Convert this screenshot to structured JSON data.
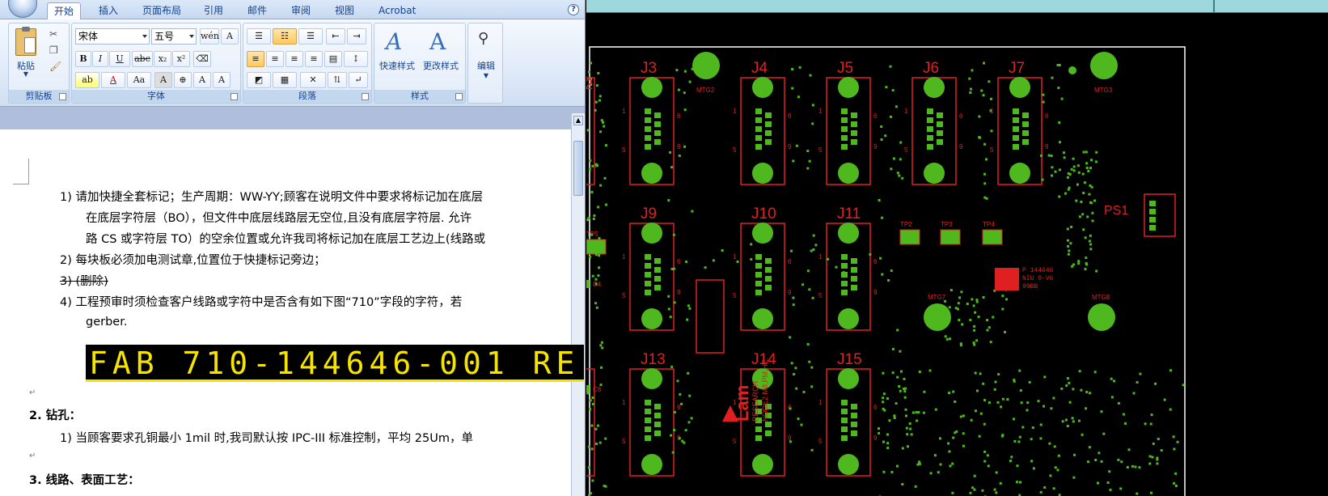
{
  "ribbon": {
    "tabs": [
      "开始",
      "插入",
      "页面布局",
      "引用",
      "邮件",
      "审阅",
      "视图",
      "Acrobat"
    ],
    "active_tab": "开始",
    "clipboard": {
      "paste_label": "粘贴",
      "group_label": "剪贴板"
    },
    "font": {
      "name": "宋体",
      "size": "五号",
      "group_label": "字体"
    },
    "paragraph": {
      "group_label": "段落"
    },
    "styles": {
      "quick_styles_label": "快速样式",
      "change_styles_label": "更改样式",
      "group_label": "样式"
    },
    "editing": {
      "edit_label": "编辑"
    }
  },
  "document": {
    "item1_line1": "1)   请加快捷全套标记；生产周期：WW-YY;顾客在说明文件中要求将标记加在底层",
    "item1_line2": "在底层字符层（BO），但文件中底层线路层无空位,且没有底层字符层.  允许",
    "item1_line3": "路 CS 或字符层 TO）的空余位置或允许我司将标记加在底层工艺边上(线路或",
    "item2": "2)   每块板必须加电测试章,位置位于快捷标记旁边；",
    "item3": "3)   (删除)",
    "item4_line1": "4)   工程预审时须检查客户线路或字符中是否含有如下图“710”字段的字符，若",
    "item4_line2": "gerber.",
    "fab_text": "FAB 710-144646-001 RE",
    "section2": "2.    钻孔：",
    "section2_item1": "1)   当顾客要求孔铜最小 1mil 时,我司默认按 IPC-III 标准控制，平均 25Um，单",
    "section3": "3.    线路、表面工艺："
  },
  "pcb": {
    "connectors_row1": [
      "J3",
      "J4",
      "J5",
      "J6",
      "J7"
    ],
    "connectors_row2": [
      "J9",
      "J10",
      "J11"
    ],
    "connectors_row3": [
      "J13",
      "J14",
      "J15"
    ],
    "partial_label": "2",
    "mtg_labels": [
      "MTG2",
      "MTG3",
      "MTG7",
      "MTG8"
    ],
    "tp_labels": [
      "TP2",
      "TP3",
      "TP4",
      "TP5"
    ],
    "c_labels": [
      "C4",
      "C8"
    ],
    "ps_label": "PS1",
    "pin_numbers": [
      "1",
      "5",
      "6",
      "9"
    ],
    "brand_text": "Lam",
    "brand_sub": "RESEARCH",
    "node_text": "NODE2 M8,PM,HE",
    "logo_text_line1": "P 144646",
    "logo_text_line2": "NIU 9-V6",
    "logo_text_line3": "99BB",
    "colors": {
      "pad": "#4fb81f",
      "outline": "#e02020",
      "board_edge": "#ffffff"
    }
  }
}
